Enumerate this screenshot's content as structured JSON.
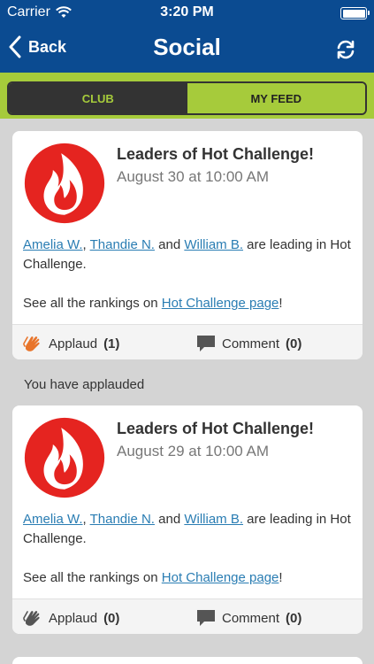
{
  "status": {
    "carrier": "Carrier",
    "time": "3:20 PM"
  },
  "nav": {
    "back_label": "Back",
    "title": "Social"
  },
  "tabs": {
    "club": "CLUB",
    "feed": "MY FEED"
  },
  "colors": {
    "nav_blue": "#0b4b91",
    "tab_green": "#a6cb3b",
    "link": "#2a7db3",
    "applaud_active": "#e8742a",
    "icon_gray": "#555555"
  },
  "posts": [
    {
      "title": "Leaders of Hot Challenge!",
      "date": "August 30 at 10:00 AM",
      "leader1": "Amelia W.",
      "sep1": ", ",
      "leader2": "Thandie N.",
      "and": " and ",
      "leader3": "William B.",
      "leading_text": " are leading in Hot Challenge.",
      "rankings_prefix": "See all the rankings on ",
      "rankings_link": "Hot Challenge page",
      "rankings_suffix": "!",
      "applaud_label": "Applaud",
      "applaud_count": "(1)",
      "comment_label": "Comment",
      "comment_count": "(0)",
      "icon": "flame-icon"
    },
    {
      "title": "Leaders of Hot Challenge!",
      "date": "August 29 at 10:00 AM",
      "leader1": "Amelia W.",
      "sep1": ", ",
      "leader2": "Thandie N.",
      "and": " and ",
      "leader3": "William B.",
      "leading_text": " are leading in Hot Challenge.",
      "rankings_prefix": "See all the rankings on ",
      "rankings_link": "Hot Challenge page",
      "rankings_suffix": "!",
      "applaud_label": "Applaud",
      "applaud_count": "(0)",
      "comment_label": "Comment",
      "comment_count": "(0)",
      "icon": "flame-icon"
    }
  ],
  "applauded_note": "You have applauded"
}
